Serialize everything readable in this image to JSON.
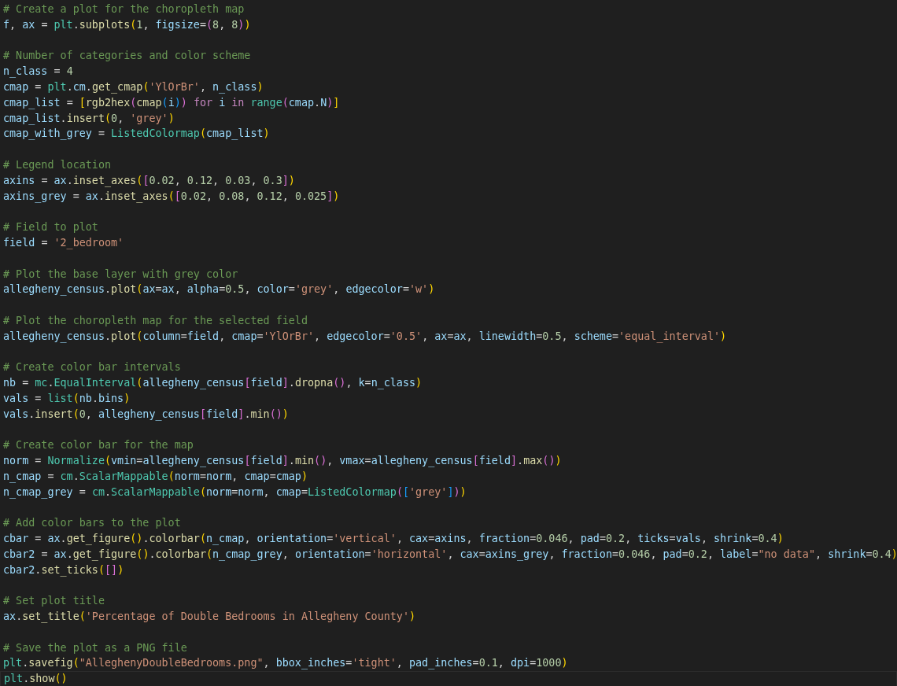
{
  "editor": {
    "blocks": [
      {
        "lines": [
          {
            "text": "# Create a plot for the choropleth map",
            "current": false
          },
          {
            "text": "f, ax = plt.subplots(1, figsize=(8, 8))",
            "current": false
          }
        ]
      },
      {
        "lines": [
          {
            "text": "# Number of categories and color scheme",
            "current": false
          },
          {
            "text": "n_class = 4",
            "current": false
          },
          {
            "text": "cmap = plt.cm.get_cmap('YlOrBr', n_class)",
            "current": false
          },
          {
            "text": "cmap_list = [rgb2hex(cmap(i)) for i in range(cmap.N)]",
            "current": false
          },
          {
            "text": "cmap_list.insert(0, 'grey')",
            "current": false
          },
          {
            "text": "cmap_with_grey = ListedColormap(cmap_list)",
            "current": false
          }
        ]
      },
      {
        "lines": [
          {
            "text": "# Legend location",
            "current": false
          },
          {
            "text": "axins = ax.inset_axes([0.02, 0.12, 0.03, 0.3])",
            "current": false
          },
          {
            "text": "axins_grey = ax.inset_axes([0.02, 0.08, 0.12, 0.025])",
            "current": false
          }
        ]
      },
      {
        "lines": [
          {
            "text": "# Field to plot",
            "current": false
          },
          {
            "text": "field = '2_bedroom'",
            "current": false
          }
        ]
      },
      {
        "lines": [
          {
            "text": "# Plot the base layer with grey color",
            "current": false
          },
          {
            "text": "allegheny_census.plot(ax=ax, alpha=0.5, color='grey', edgecolor='w')",
            "current": false
          }
        ]
      },
      {
        "lines": [
          {
            "text": "# Plot the choropleth map for the selected field",
            "current": false
          },
          {
            "text": "allegheny_census.plot(column=field, cmap='YlOrBr', edgecolor='0.5', ax=ax, linewidth=0.5, scheme='equal_interval')",
            "current": false
          }
        ]
      },
      {
        "lines": [
          {
            "text": "# Create color bar intervals",
            "current": false
          },
          {
            "text": "nb = mc.EqualInterval(allegheny_census[field].dropna(), k=n_class)",
            "current": false
          },
          {
            "text": "vals = list(nb.bins)",
            "current": false
          },
          {
            "text": "vals.insert(0, allegheny_census[field].min())",
            "current": false
          }
        ]
      },
      {
        "lines": [
          {
            "text": "# Create color bar for the map",
            "current": false
          },
          {
            "text": "norm = Normalize(vmin=allegheny_census[field].min(), vmax=allegheny_census[field].max())",
            "current": false
          },
          {
            "text": "n_cmap = cm.ScalarMappable(norm=norm, cmap=cmap)",
            "current": false
          },
          {
            "text": "n_cmap_grey = cm.ScalarMappable(norm=norm, cmap=ListedColormap(['grey']))",
            "current": false
          }
        ]
      },
      {
        "lines": [
          {
            "text": "# Add color bars to the plot",
            "current": false
          },
          {
            "text": "cbar = ax.get_figure().colorbar(n_cmap, orientation='vertical', cax=axins, fraction=0.046, pad=0.2, ticks=vals, shrink=0.4)",
            "current": false
          },
          {
            "text": "cbar2 = ax.get_figure().colorbar(n_cmap_grey, orientation='horizontal', cax=axins_grey, fraction=0.046, pad=0.2, label=\"no data\", shrink=0.4)",
            "current": false
          },
          {
            "text": "cbar2.set_ticks([])",
            "current": false
          }
        ]
      },
      {
        "lines": [
          {
            "text": "# Set plot title",
            "current": false
          },
          {
            "text": "ax.set_title('Percentage of Double Bedrooms in Allegheny County')",
            "current": false
          }
        ]
      },
      {
        "lines": [
          {
            "text": "# Save the plot as a PNG file",
            "current": false
          },
          {
            "text": "plt.savefig(\"AlleghenyDoubleBedrooms.png\", bbox_inches='tight', pad_inches=0.1, dpi=1000)",
            "current": false
          },
          {
            "text": "plt.show()",
            "current": true
          }
        ]
      }
    ]
  }
}
